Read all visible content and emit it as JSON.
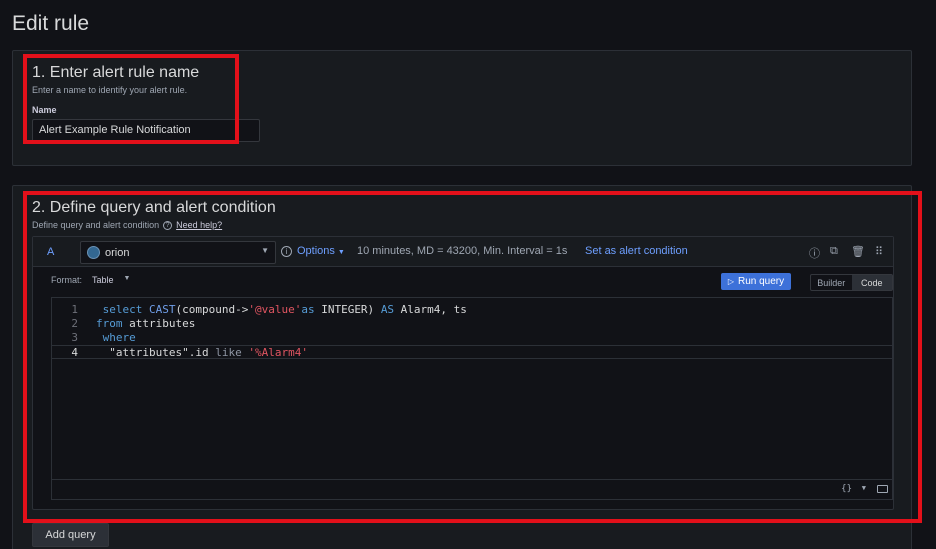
{
  "page": {
    "title": "Edit rule"
  },
  "section1": {
    "title": "1. Enter alert rule name",
    "subtitle": "Enter a name to identify your alert rule.",
    "name_label": "Name",
    "name_value": "Alert Example Rule Notification"
  },
  "section2": {
    "title": "2. Define query and alert condition",
    "subtitle": "Define query and alert condition",
    "help_link": "Need help?",
    "query": {
      "ref_id": "A",
      "datasource": "orion",
      "options_label": "Options",
      "options_info": "10 minutes, MD = 43200, Min. Interval = 1s",
      "set_condition": "Set as alert condition",
      "format_label": "Format:",
      "format_value": "Table",
      "run_query": "Run query",
      "mode_builder": "Builder",
      "mode_code": "Code",
      "code_lines": [
        {
          "n": "1",
          "parts": [
            {
              "t": " select ",
              "c": "kw"
            },
            {
              "t": "CAST",
              "c": "fn"
            },
            {
              "t": "(compound->",
              "c": ""
            },
            {
              "t": "'@value'",
              "c": "str"
            },
            {
              "t": "as",
              "c": "kw"
            },
            {
              "t": " INTEGER) ",
              "c": ""
            },
            {
              "t": "AS",
              "c": "kw"
            },
            {
              "t": " Alarm4, ts",
              "c": ""
            }
          ]
        },
        {
          "n": "2",
          "parts": [
            {
              "t": "from",
              "c": "kw"
            },
            {
              "t": " attributes",
              "c": ""
            }
          ]
        },
        {
          "n": "3",
          "parts": [
            {
              "t": " where",
              "c": "kw"
            }
          ]
        },
        {
          "n": "4",
          "parts": [
            {
              "t": "  \"attributes\".id ",
              "c": ""
            },
            {
              "t": "like",
              "c": "like-kw"
            },
            {
              "t": " ",
              "c": ""
            },
            {
              "t": "'%Alarm4'",
              "c": "str"
            }
          ]
        }
      ],
      "footer_braces": "{}"
    },
    "add_query": "Add query"
  },
  "colors": {
    "annotation": "#e3101a",
    "link": "#6e9fff",
    "primary": "#3d71d9"
  }
}
